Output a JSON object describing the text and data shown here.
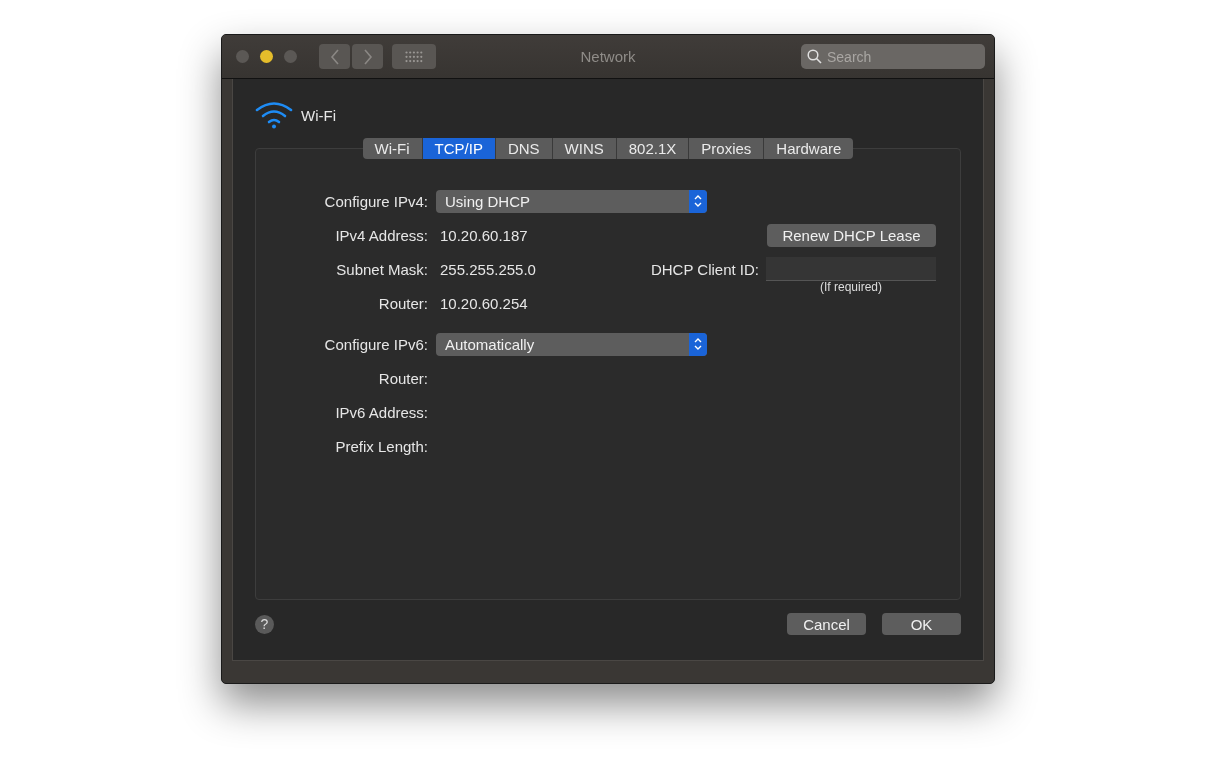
{
  "window": {
    "title": "Network"
  },
  "search": {
    "placeholder": "Search"
  },
  "interface": {
    "name": "Wi-Fi"
  },
  "tabs": [
    {
      "label": "Wi-Fi",
      "selected": false
    },
    {
      "label": "TCP/IP",
      "selected": true
    },
    {
      "label": "DNS",
      "selected": false
    },
    {
      "label": "WINS",
      "selected": false
    },
    {
      "label": "802.1X",
      "selected": false
    },
    {
      "label": "Proxies",
      "selected": false
    },
    {
      "label": "Hardware",
      "selected": false
    }
  ],
  "ipv4": {
    "configure": {
      "label": "Configure IPv4:",
      "value": "Using DHCP"
    },
    "fields": [
      {
        "label": "IPv4 Address:",
        "value": "10.20.60.187"
      },
      {
        "label": "Subnet Mask:",
        "value": "255.255.255.0"
      },
      {
        "label": "Router:",
        "value": "10.20.60.254"
      }
    ],
    "renew_button": "Renew DHCP Lease",
    "client_id": {
      "label": "DHCP Client ID:",
      "hint": "(If required)"
    }
  },
  "ipv6": {
    "configure": {
      "label": "Configure IPv6:",
      "value": "Automatically"
    },
    "fields": [
      {
        "label": "Router:"
      },
      {
        "label": "IPv6 Address:"
      },
      {
        "label": "Prefix Length:"
      }
    ]
  },
  "help_button": "?",
  "buttons": [
    "Cancel",
    "OK"
  ]
}
